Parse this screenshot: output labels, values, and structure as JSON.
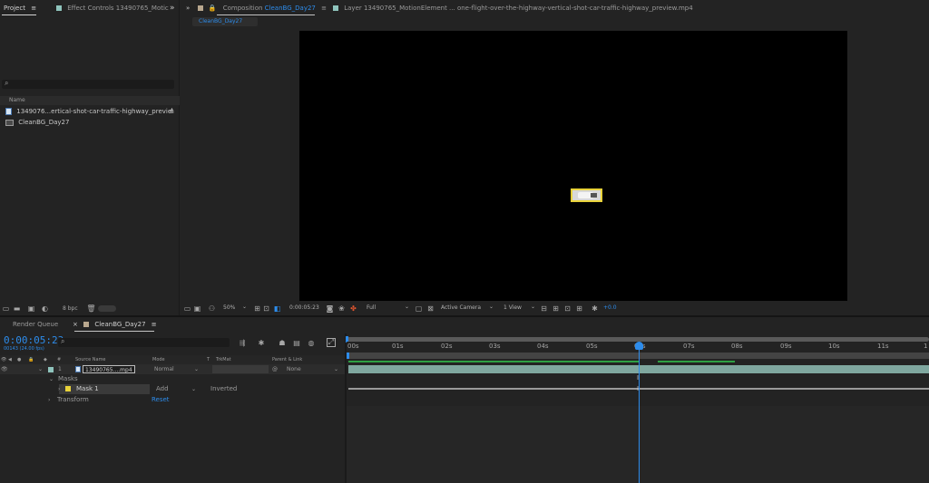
{
  "project_panel": {
    "tab_label": "Project",
    "menu_glyph": "≡",
    "effect_tab": "Effect Controls 13490765_Motic",
    "search_icon": "search-icon",
    "column_name": "Name",
    "items": [
      {
        "label": "1349076...ertical-shot-car-traffic-highway_previe",
        "icon": "footage-icon"
      },
      {
        "label": "CleanBG_Day27",
        "icon": "composition-icon"
      }
    ],
    "bpc_label": "8 bpc"
  },
  "viewer": {
    "comp_tab_prefix": "Composition",
    "comp_name": "CleanBG_Day27",
    "layer_tab": "Layer 13490765_MotionElement ... one-flight-over-the-highway-vertical-shot-car-traffic-highway_preview.mp4",
    "sub_tab": "CleanBG_Day27",
    "zoom": "50%",
    "timecode": "0:00:05:23",
    "resolution": "Full",
    "camera": "Active Camera",
    "view": "1 View",
    "exposure": "+0.0"
  },
  "timeline": {
    "render_queue_tab": "Render Queue",
    "comp_tab": "CleanBG_Day27",
    "timecode": "0:00:05:23",
    "frame_info": "00143 (24.00 fps)",
    "columns": {
      "number": "#",
      "source_name": "Source Name",
      "mode": "Mode",
      "t": "T",
      "trkmat": "TrkMat",
      "parent": "Parent & Link"
    },
    "layer": {
      "number": "1",
      "name": "13490765....mp4",
      "mode": "Normal",
      "parent": "None"
    },
    "masks_label": "Masks",
    "mask": {
      "name": "Mask 1",
      "mode": "Add",
      "inverted": "Inverted"
    },
    "transform_label": "Transform",
    "reset_label": "Reset",
    "ruler": [
      "00s",
      "01s",
      "02s",
      "03s",
      "04s",
      "05s",
      "06s",
      "07s",
      "08s",
      "09s",
      "10s",
      "11s",
      "1"
    ]
  },
  "colors": {
    "accent": "#2d8ceb",
    "green_bar": "#2ea043",
    "track": "#7fa79f",
    "mask_yellow": "#e8d23a"
  }
}
